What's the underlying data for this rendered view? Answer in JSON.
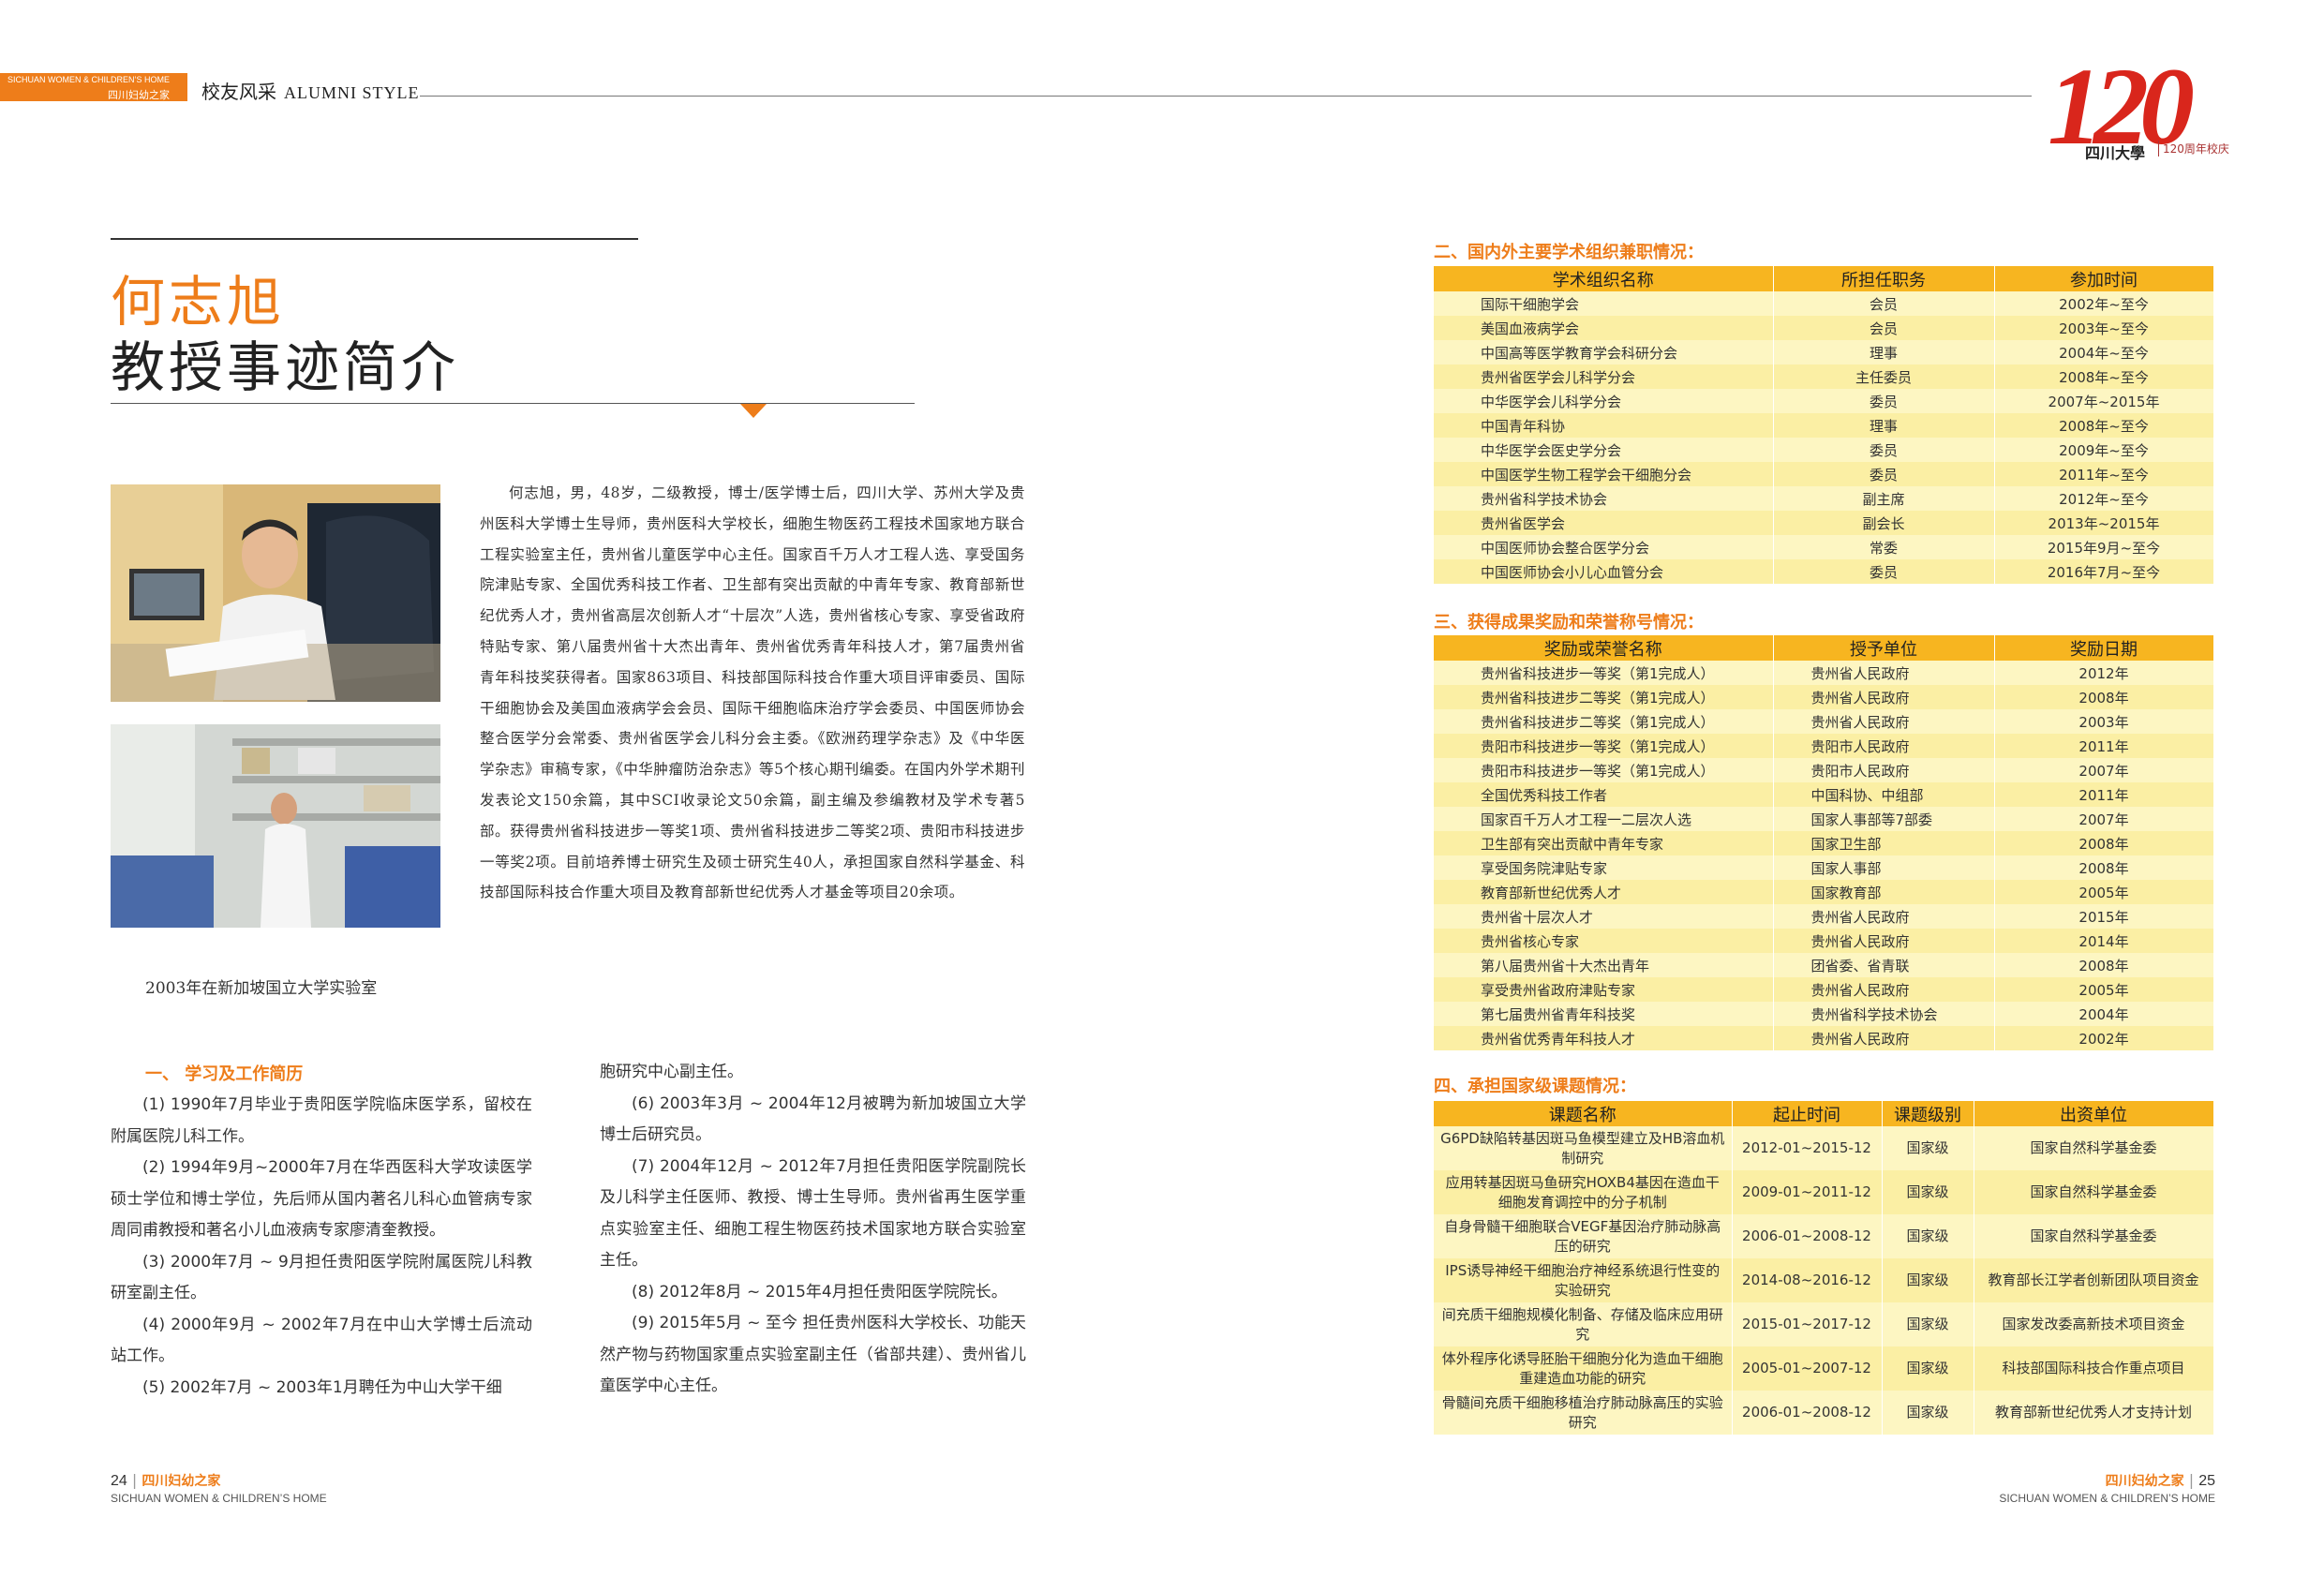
{
  "header": {
    "tab_en": "SICHUAN WOMEN & CHILDREN’S HOME",
    "tab_cn": "四川妇幼之家",
    "section_cn": "校友风采",
    "section_en": "ALUMNI STYLE"
  },
  "logo": {
    "number": "120",
    "university": "四川大學",
    "anniversary": "120周年校庆"
  },
  "title": {
    "name": "何志旭",
    "subtitle": "教授事迹简介"
  },
  "photo_caption": "2003年在新加坡国立大学实验室",
  "bio": "何志旭，男，48岁，二级教授，博士/医学博士后，四川大学、苏州大学及贵州医科大学博士生导师，贵州医科大学校长，细胞生物医药工程技术国家地方联合工程实验室主任，贵州省儿童医学中心主任。国家百千万人才工程人选、享受国务院津贴专家、全国优秀科技工作者、卫生部有突出贡献的中青年专家、教育部新世纪优秀人才，贵州省高层次创新人才“十层次”人选，贵州省核心专家、享受省政府特贴专家、第八届贵州省十大杰出青年、贵州省优秀青年科技人才，第7届贵州省青年科技奖获得者。国家863项目、科技部国际科技合作重大项目评审委员、国际干细胞协会及美国血液病学会会员、国际干细胞临床治疗学会委员、中国医师协会整合医学分会常委、贵州省医学会儿科分会主委。《欧洲药理学杂志》及《中华医学杂志》审稿专家，《中华肿瘤防治杂志》等5个核心期刊编委。在国内外学术期刊发表论文150余篇，其中SCI收录论文50余篇，副主编及参编教材及学术专著5部。获得贵州省科技进步一等奖1项、贵州省科技进步二等奖2项、贵阳市科技进步一等奖2项。目前培养博士研究生及硕士研究生40人，承担国家自然科学基金、科技部国际科技合作重大项目及教育部新世纪优秀人才基金等项目20余项。",
  "resume": {
    "heading": "一、  学习及工作简历",
    "left": [
      "(1) 1990年7月毕业于贵阳医学院临床医学系，留校在附属医院儿科工作。",
      "(2) 1994年9月~2000年7月在华西医科大学攻读医学硕士学位和博士学位，先后师从国内著名儿科心血管病专家周同甫教授和著名小儿血液病专家廖清奎教授。",
      "(3) 2000年7月 ~ 9月担任贵阳医学院附属医院儿科教研室副主任。",
      "(4) 2000年9月 ~ 2002年7月在中山大学博士后流动站工作。",
      "(5) 2002年7月 ~ 2003年1月聘任为中山大学干细"
    ],
    "right_continuation": "胞研究中心副主任。",
    "right": [
      "(6) 2003年3月 ~ 2004年12月被聘为新加坡国立大学博士后研究员。",
      "(7) 2004年12月 ~ 2012年7月担任贵阳医学院副院长及儿科学主任医师、教授、博士生导师。贵州省再生医学重点实验室主任、细胞工程生物医药技术国家地方联合实验室主任。",
      "(8) 2012年8月 ~ 2015年4月担任贵阳医学院院长。",
      "(9) 2015年5月 ~ 至今 担任贵州医科大学校长、功能天然产物与药物国家重点实验室副主任（省部共建）、贵州省儿童医学中心主任。"
    ]
  },
  "section2": {
    "heading": "二、国内外主要学术组织兼职情况：",
    "headers": [
      "学术组织名称",
      "所担任职务",
      "参加时间"
    ],
    "rows": [
      [
        "国际干细胞学会",
        "会员",
        "2002年~至今"
      ],
      [
        "美国血液病学会",
        "会员",
        "2003年~至今"
      ],
      [
        "中国高等医学教育学会科研分会",
        "理事",
        "2004年~至今"
      ],
      [
        "贵州省医学会儿科学分会",
        "主任委员",
        "2008年~至今"
      ],
      [
        "中华医学会儿科学分会",
        "委员",
        "2007年~2015年"
      ],
      [
        "中国青年科协",
        "理事",
        "2008年~至今"
      ],
      [
        "中华医学会医史学分会",
        "委员",
        "2009年~至今"
      ],
      [
        "中国医学生物工程学会干细胞分会",
        "委员",
        "2011年~至今"
      ],
      [
        "贵州省科学技术协会",
        "副主席",
        "2012年~至今"
      ],
      [
        "贵州省医学会",
        "副会长",
        "2013年~2015年"
      ],
      [
        "中国医师协会整合医学分会",
        "常委",
        "2015年9月~至今"
      ],
      [
        "中国医师协会小儿心血管分会",
        "委员",
        "2016年7月~至今"
      ]
    ]
  },
  "section3": {
    "heading": "三、获得成果奖励和荣誉称号情况：",
    "headers": [
      "奖励或荣誉名称",
      "授予单位",
      "奖励日期"
    ],
    "rows": [
      [
        "贵州省科技进步一等奖（第1完成人）",
        "贵州省人民政府",
        "2012年"
      ],
      [
        "贵州省科技进步二等奖（第1完成人）",
        "贵州省人民政府",
        "2008年"
      ],
      [
        "贵州省科技进步二等奖（第1完成人）",
        "贵州省人民政府",
        "2003年"
      ],
      [
        "贵阳市科技进步一等奖（第1完成人）",
        "贵阳市人民政府",
        "2011年"
      ],
      [
        "贵阳市科技进步一等奖（第1完成人）",
        "贵阳市人民政府",
        "2007年"
      ],
      [
        "全国优秀科技工作者",
        "中国科协、中组部",
        "2011年"
      ],
      [
        "国家百千万人才工程一二层次人选",
        "国家人事部等7部委",
        "2007年"
      ],
      [
        "卫生部有突出贡献中青年专家",
        "国家卫生部",
        "2008年"
      ],
      [
        "享受国务院津贴专家",
        "国家人事部",
        "2008年"
      ],
      [
        "教育部新世纪优秀人才",
        "国家教育部",
        "2005年"
      ],
      [
        "贵州省十层次人才",
        "贵州省人民政府",
        "2015年"
      ],
      [
        "贵州省核心专家",
        "贵州省人民政府",
        "2014年"
      ],
      [
        "第八届贵州省十大杰出青年",
        "团省委、省青联",
        "2008年"
      ],
      [
        "享受贵州省政府津贴专家",
        "贵州省人民政府",
        "2005年"
      ],
      [
        "第七届贵州省青年科技奖",
        "贵州省科学技术协会",
        "2004年"
      ],
      [
        "贵州省优秀青年科技人才",
        "贵州省人民政府",
        "2002年"
      ]
    ]
  },
  "section4": {
    "heading": "四、承担国家级课题情况：",
    "headers": [
      "课题名称",
      "起止时间",
      "课题级别",
      "出资单位"
    ],
    "rows": [
      [
        "G6PD缺陷转基因斑马鱼模型建立及HB溶血机制研究",
        "2012-01~2015-12",
        "国家级",
        "国家自然科学基金委"
      ],
      [
        "应用转基因斑马鱼研究HOXB4基因在造血干细胞发育调控中的分子机制",
        "2009-01~2011-12",
        "国家级",
        "国家自然科学基金委"
      ],
      [
        "自身骨髓干细胞联合VEGF基因治疗肺动脉高压的研究",
        "2006-01~2008-12",
        "国家级",
        "国家自然科学基金委"
      ],
      [
        "IPS诱导神经干细胞治疗神经系统退行性变的实验研究",
        "2014-08~2016-12",
        "国家级",
        "教育部长江学者创新团队项目资金"
      ],
      [
        "间充质干细胞规模化制备、存储及临床应用研究",
        "2015-01~2017-12",
        "国家级",
        "国家发改委高新技术项目资金"
      ],
      [
        "体外程序化诱导胚胎干细胞分化为造血干细胞重建造血功能的研究",
        "2005-01~2007-12",
        "国家级",
        "科技部国际科技合作重点项目"
      ],
      [
        "骨髓间充质干细胞移植治疗肺动脉高压的实验研究",
        "2006-01~2008-12",
        "国家级",
        "教育部新世纪优秀人才支持计划"
      ]
    ]
  },
  "footer": {
    "left_page": "24",
    "right_page": "25",
    "magazine_cn": "四川妇幼之家",
    "magazine_en": "SICHUAN WOMEN & CHILDREN’S HOME"
  }
}
